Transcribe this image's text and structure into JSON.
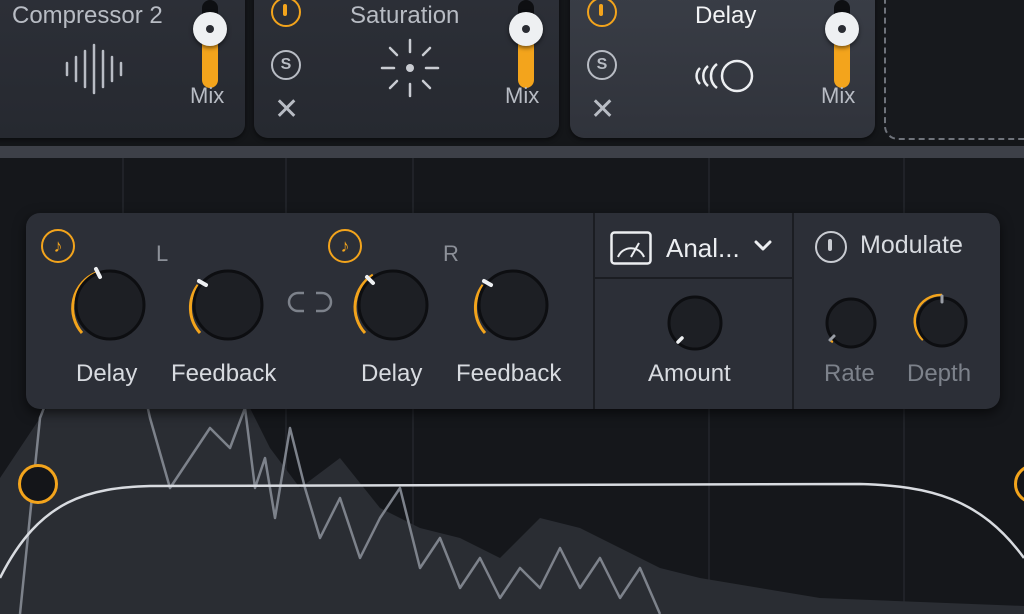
{
  "modules": [
    {
      "title": "Compressor 2",
      "mix_label": "Mix",
      "icon": "compressor-waveform-icon",
      "mix": 0.7
    },
    {
      "title": "Saturation",
      "mix_label": "Mix",
      "icon": "saturation-burst-icon",
      "solo": "S",
      "mix": 0.7
    },
    {
      "title": "Delay",
      "mix_label": "Mix",
      "icon": "delay-echo-icon",
      "solo": "S",
      "mix": 0.7
    }
  ],
  "delay_panel": {
    "left": {
      "channel": "L",
      "delay_label": "Delay",
      "feedback_label": "Feedback"
    },
    "right": {
      "channel": "R",
      "delay_label": "Delay",
      "feedback_label": "Feedback"
    },
    "sync_glyph": "♪",
    "mode": {
      "value": "Anal...",
      "icon": "analog-meter-icon"
    },
    "amount_label": "Amount",
    "modulate": {
      "label": "Modulate",
      "rate_label": "Rate",
      "depth_label": "Depth"
    }
  },
  "colors": {
    "accent": "#f3a41c",
    "background": "#15171b",
    "panel": "#2c2f37"
  }
}
